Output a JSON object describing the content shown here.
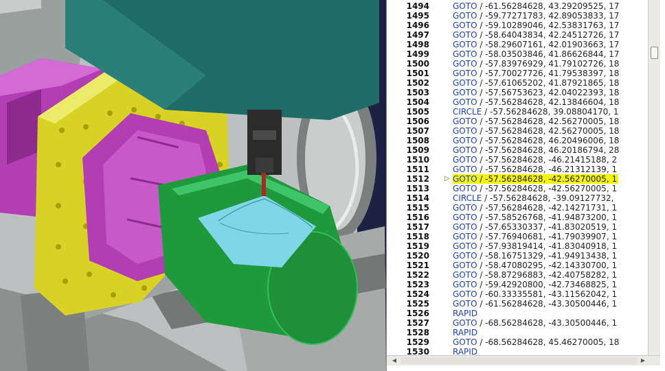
{
  "code_lines": [
    {
      "num": "1494",
      "kw": "GOTO",
      "rest": " / -61.56284628, 43.29209525, 17"
    },
    {
      "num": "1495",
      "kw": "GOTO",
      "rest": " / -59.77271783, 42.89053833, 17"
    },
    {
      "num": "1496",
      "kw": "GOTO",
      "rest": " / -59.10289046, 42.53831763, 17"
    },
    {
      "num": "1497",
      "kw": "GOTO",
      "rest": " / -58.64043834, 42.24512726, 17"
    },
    {
      "num": "1498",
      "kw": "GOTO",
      "rest": " / -58.29607161, 42.01903663, 17"
    },
    {
      "num": "1499",
      "kw": "GOTO",
      "rest": " / -58.03503846, 41.86626844, 17"
    },
    {
      "num": "1500",
      "kw": "GOTO",
      "rest": " / -57.83976929, 41.79102726, 18"
    },
    {
      "num": "1501",
      "kw": "GOTO",
      "rest": " / -57.70027726, 41.79538397, 18"
    },
    {
      "num": "1502",
      "kw": "GOTO",
      "rest": " / -57.61065202, 41.87921865, 18"
    },
    {
      "num": "1503",
      "kw": "GOTO",
      "rest": " / -57.56753623, 42.04022393, 18"
    },
    {
      "num": "1504",
      "kw": "GOTO",
      "rest": " / -57.56284628, 42.13846604, 18"
    },
    {
      "num": "1505",
      "kw": "CIRCLE",
      "rest": " / -57.56284628, 39.08804170, 1"
    },
    {
      "num": "1506",
      "kw": "GOTO",
      "rest": " / -57.56284628, 42.56270005, 18"
    },
    {
      "num": "1507",
      "kw": "GOTO",
      "rest": " / -57.56284628, 42.56270005, 18"
    },
    {
      "num": "1508",
      "kw": "GOTO",
      "rest": " / -57.56284628, 46.20496006, 18"
    },
    {
      "num": "1509",
      "kw": "GOTO",
      "rest": " / -57.56284628, 46.20186794, 28"
    },
    {
      "num": "1510",
      "kw": "GOTO",
      "rest": " / -57.56284628, -46.21415188, 2"
    },
    {
      "num": "1511",
      "kw": "GOTO",
      "rest": " / -57.56284628, -46.21312139, 1"
    },
    {
      "num": "1512",
      "kw": "GOTO",
      "rest": " / -57.56284628, -42.56270005, 1",
      "current": true
    },
    {
      "num": "1513",
      "kw": "GOTO",
      "rest": " / -57.56284628, -42.56270005, 1"
    },
    {
      "num": "1514",
      "kw": "CIRCLE",
      "rest": " / -57.56284628, -39.09127732,"
    },
    {
      "num": "1515",
      "kw": "GOTO",
      "rest": " / -57.56284628, -42.14271731, 1"
    },
    {
      "num": "1516",
      "kw": "GOTO",
      "rest": " / -57.58526768, -41.94873200, 1"
    },
    {
      "num": "1517",
      "kw": "GOTO",
      "rest": " / -57.65330337, -41.83020519, 1"
    },
    {
      "num": "1518",
      "kw": "GOTO",
      "rest": " / -57.76940681, -41.79039907, 1"
    },
    {
      "num": "1519",
      "kw": "GOTO",
      "rest": " / -57.93819414, -41.83040918, 1"
    },
    {
      "num": "1520",
      "kw": "GOTO",
      "rest": " / -58.16751329, -41.94913438, 1"
    },
    {
      "num": "1521",
      "kw": "GOTO",
      "rest": " / -58.47080295, -42.14330700, 1"
    },
    {
      "num": "1522",
      "kw": "GOTO",
      "rest": " / -58.87296883, -42.40758282, 1"
    },
    {
      "num": "1523",
      "kw": "GOTO",
      "rest": " / -59.42920800, -42.73468825, 1"
    },
    {
      "num": "1524",
      "kw": "GOTO",
      "rest": " / -60.33335581, -43.11562042, 1"
    },
    {
      "num": "1525",
      "kw": "GOTO",
      "rest": " / -61.56284628, -43.30500446, 1"
    },
    {
      "num": "1526",
      "kw": "RAPID",
      "rest": ""
    },
    {
      "num": "1527",
      "kw": "GOTO",
      "rest": " / -68.56284628, -43.30500446, 1"
    },
    {
      "num": "1528",
      "kw": "RAPID",
      "rest": ""
    },
    {
      "num": "1529",
      "kw": "GOTO",
      "rest": " / -68.56284628, 45.46270005, 18"
    },
    {
      "num": "1530",
      "kw": "RAPID",
      "rest": ""
    }
  ],
  "current_marker": "▷",
  "icons": {
    "current_line": "play-outline-icon",
    "scroll_left": "triangle-left-icon",
    "scroll_right": "triangle-right-icon"
  },
  "colors": {
    "keyword": "#1c3fb8",
    "highlight": "#f4f40f",
    "workpiece": "#1e9a3c",
    "pocket": "#7fd6e6",
    "fixture_magenta": "#b33db3",
    "fixture_yellow": "#d7d225",
    "spindle_head": "#1f6b66"
  }
}
